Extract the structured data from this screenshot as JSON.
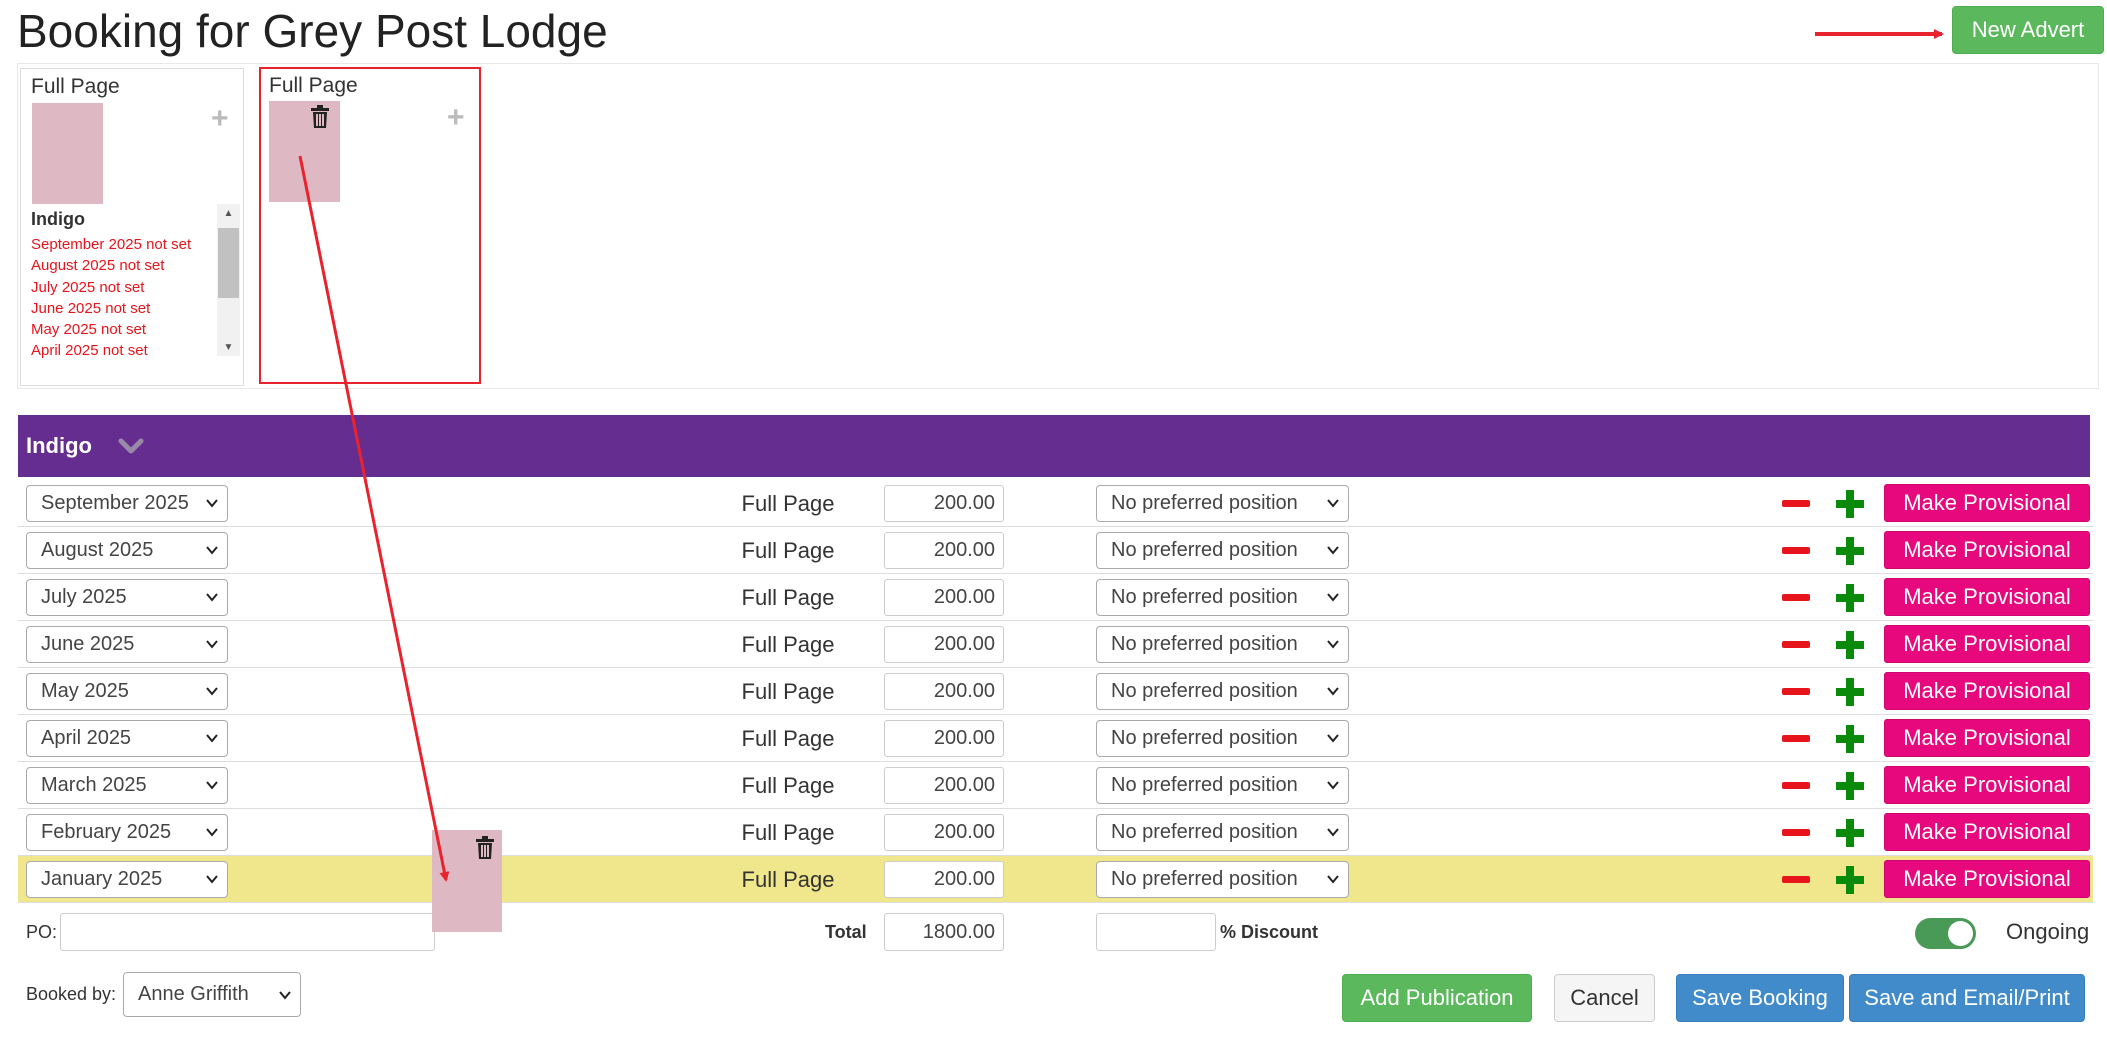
{
  "page": {
    "title": "Booking for Grey Post Lodge"
  },
  "header": {
    "new_advert_label": "New Advert"
  },
  "gallery": {
    "cards": [
      {
        "title": "Full Page",
        "publication": "Indigo",
        "missing": [
          "September 2025 not set",
          "August 2025 not set",
          "July 2025 not set",
          "June 2025 not set",
          "May 2025 not set",
          "April 2025 not set"
        ]
      },
      {
        "title": "Full Page"
      }
    ]
  },
  "publication": {
    "name": "Indigo",
    "rows": [
      {
        "month": "September 2025",
        "size": "Full Page",
        "price": "200.00",
        "position": "No preferred position",
        "action": "Make Provisional"
      },
      {
        "month": "August 2025",
        "size": "Full Page",
        "price": "200.00",
        "position": "No preferred position",
        "action": "Make Provisional"
      },
      {
        "month": "July 2025",
        "size": "Full Page",
        "price": "200.00",
        "position": "No preferred position",
        "action": "Make Provisional"
      },
      {
        "month": "June 2025",
        "size": "Full Page",
        "price": "200.00",
        "position": "No preferred position",
        "action": "Make Provisional"
      },
      {
        "month": "May 2025",
        "size": "Full Page",
        "price": "200.00",
        "position": "No preferred position",
        "action": "Make Provisional"
      },
      {
        "month": "April 2025",
        "size": "Full Page",
        "price": "200.00",
        "position": "No preferred position",
        "action": "Make Provisional"
      },
      {
        "month": "March 2025",
        "size": "Full Page",
        "price": "200.00",
        "position": "No preferred position",
        "action": "Make Provisional"
      },
      {
        "month": "February 2025",
        "size": "Full Page",
        "price": "200.00",
        "position": "No preferred position",
        "action": "Make Provisional"
      },
      {
        "month": "January 2025",
        "size": "Full Page",
        "price": "200.00",
        "position": "No preferred position",
        "action": "Make Provisional",
        "highlighted": true
      }
    ],
    "po_label": "PO:",
    "po_value": "",
    "total_label": "Total",
    "total_value": "1800.00",
    "discount_value": "",
    "discount_label": "% Discount",
    "ongoing_label": "Ongoing",
    "ongoing_on": true
  },
  "footer": {
    "booked_by_label": "Booked by:",
    "booked_by_value": "Anne Griffith",
    "add_publication_label": "Add Publication",
    "cancel_label": "Cancel",
    "save_booking_label": "Save Booking",
    "save_email_label": "Save and Email/Print"
  },
  "colors": {
    "publication_bar": "#662d91",
    "provisional_button": "#e6087c",
    "highlight_row": "#f0e68c",
    "annotation_arrow": "#e8232d",
    "thumbnail": "#deb9c3"
  },
  "icons": {
    "add": "plus-icon",
    "delete": "trash-icon",
    "collapse": "chevron-down-icon",
    "remove_row": "minus-icon",
    "add_row": "plus-icon"
  }
}
